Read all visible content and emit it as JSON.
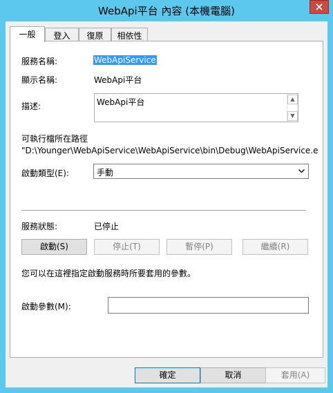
{
  "window": {
    "title": "WebApi平台 內容 (本機電腦)",
    "close_glyph": "✕",
    "close_color": "#c94b43"
  },
  "tabs": [
    {
      "label": "一般",
      "active": true
    },
    {
      "label": "登入",
      "active": false
    },
    {
      "label": "復原",
      "active": false
    },
    {
      "label": "相依性",
      "active": false
    }
  ],
  "general": {
    "service_name_label": "服務名稱:",
    "service_name_value": "WebApiService",
    "display_name_label": "顯示名稱:",
    "display_name_value": "WebApi平台",
    "description_label": "描述:",
    "description_value": "WebApi平台",
    "scroll_up_glyph": "▲",
    "scroll_down_glyph": "▼",
    "exec_path_label": "可執行檔所在路徑",
    "exec_path_value": "\"D:\\Younger\\WebApiService\\WebApiService\\bin\\Debug\\WebApiService.e",
    "startup_type_label": "啟動類型(E):",
    "startup_type_value": "手動",
    "combo_arrow_glyph": "⌄",
    "status_label": "服務狀態:",
    "status_value": "已停止",
    "hint_text": "您可以在這裡指定啟動服務時所要套用的參數。",
    "start_params_label": "啟動參數(M):",
    "start_params_value": ""
  },
  "service_buttons": [
    {
      "label": "啟動(S)",
      "enabled": true
    },
    {
      "label": "停止(T)",
      "enabled": false
    },
    {
      "label": "暫停(P)",
      "enabled": false
    },
    {
      "label": "繼續(R)",
      "enabled": false
    }
  ],
  "dialog_buttons": {
    "ok": "確定",
    "cancel": "取消",
    "apply": "套用(A)"
  },
  "colors": {
    "frame": "#5cc8ee",
    "selection": "#3399ff",
    "default_button_border": "#0078d7"
  }
}
